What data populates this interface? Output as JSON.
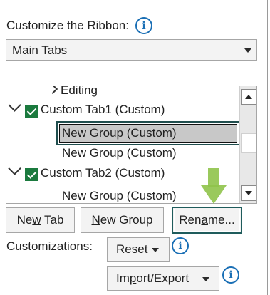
{
  "header": {
    "customize_label": "Customize the Ribbon:",
    "info_symbol": "i"
  },
  "dropdown": {
    "selected": "Main Tabs"
  },
  "tree": {
    "items": [
      {
        "label": "Editing",
        "type": "group-partial"
      },
      {
        "label": "Custom Tab1 (Custom)",
        "type": "tab",
        "checked": true,
        "expanded": true
      },
      {
        "label": "New Group (Custom)",
        "type": "group",
        "selected": true
      },
      {
        "label": "New Group (Custom)",
        "type": "group"
      },
      {
        "label": "Custom Tab2 (Custom)",
        "type": "tab",
        "checked": true,
        "expanded": true
      },
      {
        "label": "New Group (Custom)",
        "type": "group"
      }
    ]
  },
  "buttons": {
    "new_tab": {
      "pre": "Ne",
      "u": "w",
      "post": " Tab"
    },
    "new_group": {
      "pre": "",
      "u": "N",
      "post": "ew Group"
    },
    "rename": {
      "pre": "Ren",
      "u": "a",
      "post": "me..."
    },
    "reset": {
      "pre": "R",
      "u": "e",
      "post": "set"
    },
    "import_export": {
      "pre": "Im",
      "u": "p",
      "post": "ort/Export"
    }
  },
  "customizations_label": "Customizations:",
  "colors": {
    "check_green": "#1b7a3e",
    "info_blue": "#1a6fb5",
    "focus_border": "#1f5c5c",
    "arrow_green": "#8fc34a"
  }
}
